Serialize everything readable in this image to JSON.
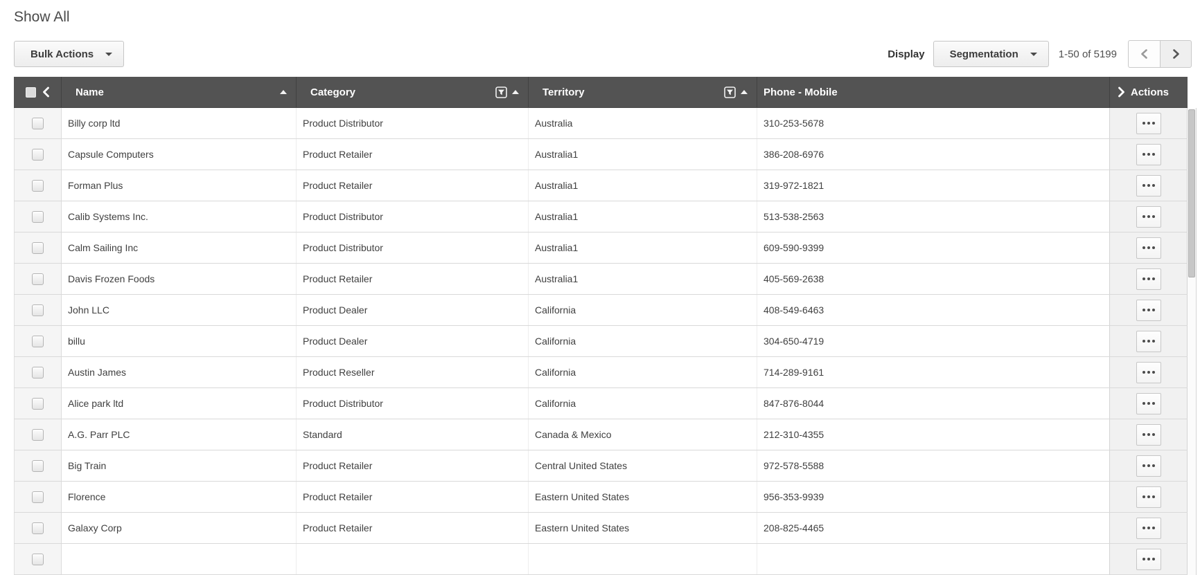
{
  "page": {
    "title": "Show All"
  },
  "toolbar": {
    "bulk_actions_label": "Bulk Actions",
    "display_label": "Display",
    "display_value": "Segmentation",
    "pagination_range": "1-50 of 5199"
  },
  "table": {
    "columns": [
      {
        "key": "name",
        "label": "Name",
        "sorted": "asc",
        "filter": false
      },
      {
        "key": "category",
        "label": "Category",
        "sorted": "asc",
        "filter": true
      },
      {
        "key": "territory",
        "label": "Territory",
        "sorted": "asc",
        "filter": true
      },
      {
        "key": "phone",
        "label": "Phone - Mobile",
        "sorted": null,
        "filter": false
      },
      {
        "key": "actions",
        "label": "Actions"
      }
    ],
    "rows": [
      {
        "name": "Billy corp ltd",
        "category": "Product Distributor",
        "territory": "Australia",
        "phone": "310-253-5678"
      },
      {
        "name": "Capsule Computers",
        "category": "Product Retailer",
        "territory": "Australia1",
        "phone": "386-208-6976"
      },
      {
        "name": "Forman Plus",
        "category": "Product Retailer",
        "territory": "Australia1",
        "phone": "319-972-1821"
      },
      {
        "name": "Calib Systems Inc.",
        "category": "Product Distributor",
        "territory": "Australia1",
        "phone": "513-538-2563"
      },
      {
        "name": "Calm Sailing Inc",
        "category": "Product Distributor",
        "territory": "Australia1",
        "phone": "609-590-9399"
      },
      {
        "name": "Davis Frozen Foods",
        "category": "Product Retailer",
        "territory": "Australia1",
        "phone": "405-569-2638"
      },
      {
        "name": "John LLC",
        "category": "Product Dealer",
        "territory": "California",
        "phone": "408-549-6463"
      },
      {
        "name": "billu",
        "category": "Product Dealer",
        "territory": "California",
        "phone": "304-650-4719"
      },
      {
        "name": "Austin James",
        "category": "Product Reseller",
        "territory": "California",
        "phone": "714-289-9161"
      },
      {
        "name": "Alice park ltd",
        "category": "Product Distributor",
        "territory": "California",
        "phone": "847-876-8044"
      },
      {
        "name": "A.G. Parr PLC",
        "category": "Standard",
        "territory": "Canada & Mexico",
        "phone": "212-310-4355"
      },
      {
        "name": "Big Train",
        "category": "Product Retailer",
        "territory": "Central United States",
        "phone": "972-578-5588"
      },
      {
        "name": "Florence",
        "category": "Product Retailer",
        "territory": "Eastern United States",
        "phone": "956-353-9939"
      },
      {
        "name": "Galaxy Corp",
        "category": "Product Retailer",
        "territory": "Eastern United States",
        "phone": "208-825-4465"
      }
    ]
  },
  "icons": {
    "caret-down": "▾",
    "sort-asc": "▲",
    "filter": "funnel-in-square",
    "collapse-chevron": "❮",
    "expand-chevron": "❯",
    "chevron-left": "‹",
    "chevron-right": "›",
    "ellipsis": "•••",
    "checkbox": "☐"
  },
  "colors": {
    "header_bg": "#535353",
    "header_text": "#ffffff",
    "row_border": "#d9d9d9",
    "select_col_bg": "#f5f5f5",
    "actions_col_bg": "#f1f1f1",
    "button_border": "#c6c6c6",
    "disabled_chevron": "#9a9a9a",
    "enabled_chevron": "#565656"
  }
}
